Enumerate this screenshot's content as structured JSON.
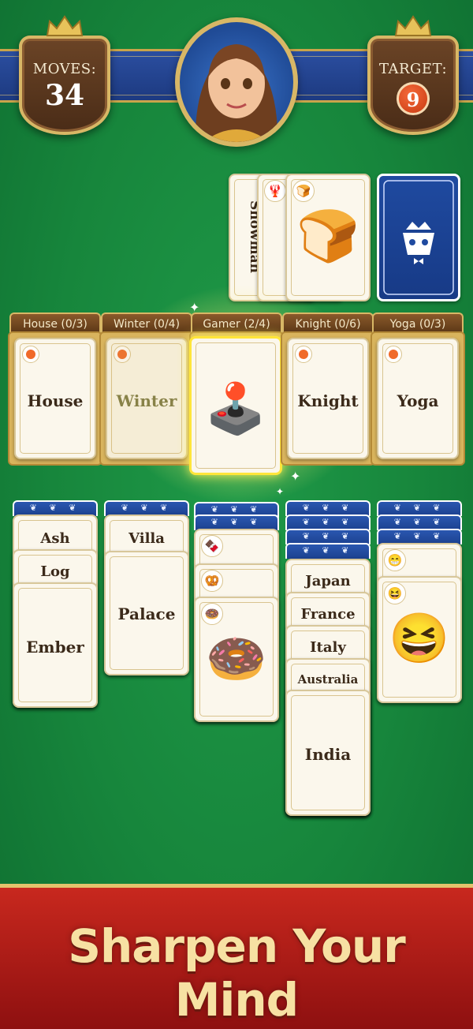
{
  "header": {
    "moves_label": "MOVES:",
    "moves_value": "34",
    "target_label": "TARGET:",
    "target_value": "9"
  },
  "waste": {
    "cards": [
      {
        "label": "Snowman"
      },
      {
        "icon": "🦞"
      },
      {
        "icon": "🍞"
      }
    ]
  },
  "categories": [
    {
      "tab": "House (0/3)",
      "card": "House"
    },
    {
      "tab": "Winter (0/4)",
      "card": "Winter"
    },
    {
      "tab": "Gamer (2/4)",
      "card": "🕹️"
    },
    {
      "tab": "Knight (0/6)",
      "card": "Knight"
    },
    {
      "tab": "Yoga (0/3)",
      "card": "Yoga"
    }
  ],
  "tableau": {
    "col1": [
      "Ash",
      "Log",
      "Ember"
    ],
    "col2": [
      "Villa",
      "Palace"
    ],
    "col3": [
      "🍫",
      "🥨",
      "🍩"
    ],
    "col4": [
      "Japan",
      "France",
      "Italy",
      "Australia",
      "India"
    ],
    "col5": [
      "😁",
      "😆"
    ]
  },
  "banner": {
    "text": "Sharpen Your Mind"
  },
  "colors": {
    "felt": "#17863c",
    "accent": "#d8b766",
    "banner": "#c8281e"
  }
}
